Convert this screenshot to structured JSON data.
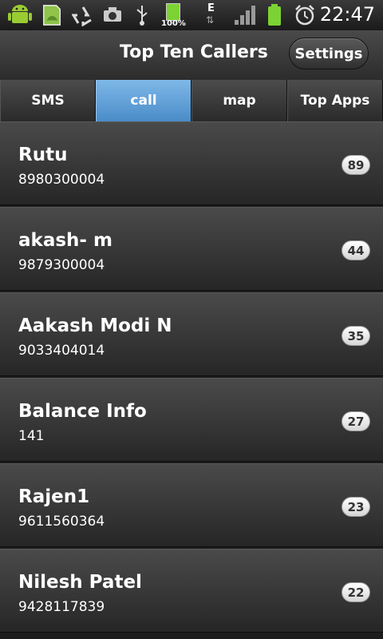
{
  "status_bar": {
    "battery_percent_label": "100%",
    "network_type": "E",
    "time": "22:47",
    "icons": [
      "android-debug-icon",
      "sd-card-icon",
      "recycle-icon",
      "camera-icon",
      "usb-icon",
      "battery-full-icon",
      "data-transfer-icon",
      "signal-icon",
      "battery-icon",
      "alarm-clock-icon"
    ]
  },
  "header": {
    "title": "Top Ten Callers",
    "settings_label": "Settings"
  },
  "tabs": [
    {
      "label": "SMS",
      "active": false
    },
    {
      "label": "call",
      "active": true
    },
    {
      "label": "map",
      "active": false
    },
    {
      "label": "Top Apps",
      "active": false
    }
  ],
  "colors": {
    "accent_tab": "#4a8cc8",
    "background": "#1c1c1c"
  },
  "callers": [
    {
      "name": "Rutu",
      "number": "8980300004",
      "count": "89"
    },
    {
      "name": "akash- m",
      "number": "9879300004",
      "count": "44"
    },
    {
      "name": "Aakash Modi N",
      "number": "9033404014",
      "count": "35"
    },
    {
      "name": "Balance Info",
      "number": "141",
      "count": "27"
    },
    {
      "name": "Rajen1",
      "number": "9611560364",
      "count": "23"
    },
    {
      "name": "Nilesh Patel",
      "number": "9428117839",
      "count": "22"
    }
  ]
}
